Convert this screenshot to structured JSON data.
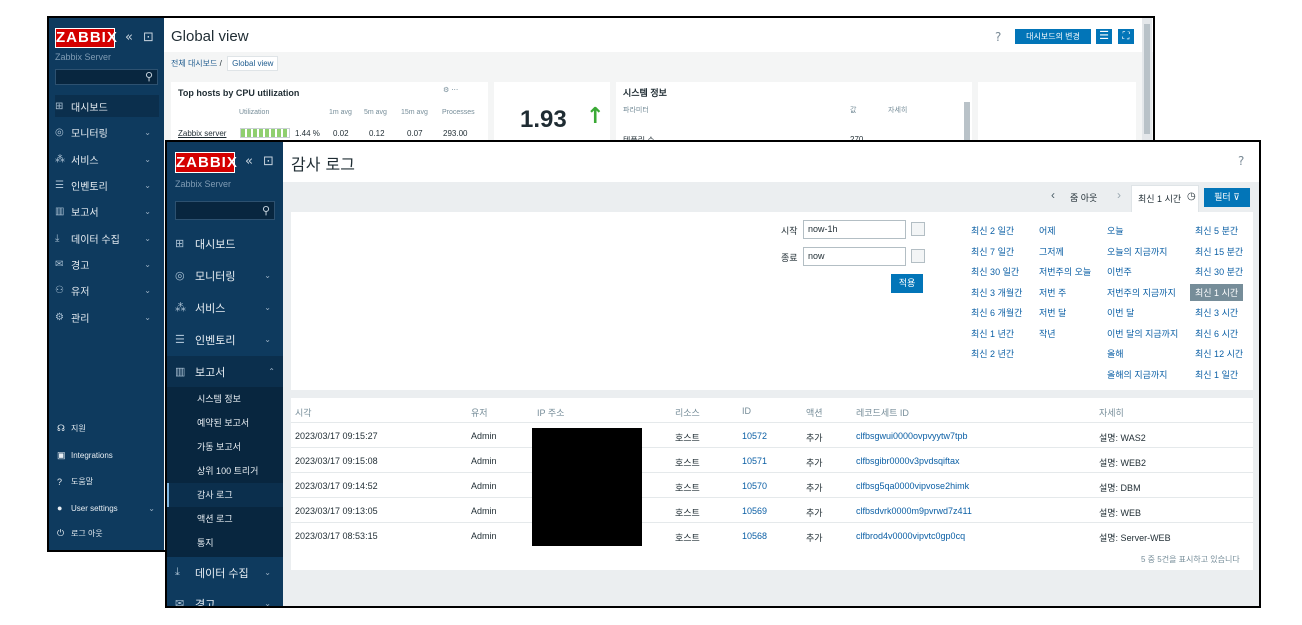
{
  "back": {
    "logo": "ZABBIX",
    "server": "Zabbix Server",
    "nav": [
      "대시보드",
      "모니터링",
      "서비스",
      "인벤토리",
      "보고서",
      "데이터 수집",
      "경고",
      "유저",
      "관리"
    ],
    "bottom": [
      "지원",
      "Integrations",
      "도움말",
      "User settings",
      "로그 아웃"
    ],
    "title": "Global view",
    "help": "?",
    "edit_button": "대시보드의 변경",
    "breadcrumb": [
      "전체 대시보드",
      "/",
      "Global view"
    ],
    "cpu_widget": {
      "title": "Top hosts by CPU utilization",
      "headers": [
        "Utilization",
        "1m avg",
        "5m avg",
        "15m avg",
        "Processes"
      ],
      "row": {
        "host": "Zabbix server",
        "util": "1.44 %",
        "m1": "0.02",
        "m5": "0.12",
        "m15": "0.07",
        "proc": "293.00"
      }
    },
    "gauge": {
      "value": "1.93"
    },
    "sysinfo": {
      "title": "시스템 정보",
      "headers": [
        "파라미터",
        "값",
        "자세히"
      ],
      "row": {
        "param": "템플릿 수",
        "value": "270"
      }
    }
  },
  "front": {
    "logo": "ZABBIX",
    "server": "Zabbix Server",
    "nav": [
      "대시보드",
      "모니터링",
      "서비스",
      "인벤토리",
      "보고서"
    ],
    "submenu": [
      "시스템 정보",
      "예약된 보고서",
      "가동 보고서",
      "상위 100 트리거",
      "감사 로그",
      "액션 로그",
      "통지"
    ],
    "nav_after": [
      "데이터 수집",
      "경고"
    ],
    "title": "감사 로그",
    "help": "?",
    "filter": {
      "zoom_out": "줌 아웃",
      "current": "최신 1 시간",
      "filter_button": "필터",
      "from_label": "시작",
      "from_value": "now-1h",
      "to_label": "종료",
      "to_value": "now",
      "apply": "적용",
      "ranges": [
        [
          "최신 2 일간",
          "최신 7 일간",
          "최신 30 일간",
          "최신 3 개월간",
          "최신 6 개월간",
          "최신 1 년간",
          "최신 2 년간"
        ],
        [
          "어제",
          "그저께",
          "저번주의 오늘",
          "저번 주",
          "저번 달",
          "작년"
        ],
        [
          "오늘",
          "오늘의 지금까지",
          "이번주",
          "저번주의 지금까지",
          "이번 달",
          "이번 달의 지금까지",
          "올해",
          "올해의 지금까지"
        ],
        [
          "최신 5 분간",
          "최신 15 분간",
          "최신 30 분간",
          "최신 1 시간",
          "최신 3 시간",
          "최신 6 시간",
          "최신 12 시간",
          "최신 1 일간"
        ]
      ]
    },
    "table": {
      "headers": [
        "시각",
        "유저",
        "IP 주소",
        "리소스",
        "ID",
        "액션",
        "레코드세트 ID",
        "자세히"
      ],
      "rows": [
        {
          "time": "2023/03/17 09:15:27",
          "user": "Admin",
          "resource": "호스트",
          "id": "10572",
          "action": "추가",
          "recordset": "clfbsgwui0000ovpvyytw7tpb",
          "details": "설명: WAS2"
        },
        {
          "time": "2023/03/17 09:15:08",
          "user": "Admin",
          "resource": "호스트",
          "id": "10571",
          "action": "추가",
          "recordset": "clfbsgibr0000v3pvdsqiftax",
          "details": "설명: WEB2"
        },
        {
          "time": "2023/03/17 09:14:52",
          "user": "Admin",
          "resource": "호스트",
          "id": "10570",
          "action": "추가",
          "recordset": "clfbsg5qa0000vipvose2himk",
          "details": "설명: DBM"
        },
        {
          "time": "2023/03/17 09:13:05",
          "user": "Admin",
          "resource": "호스트",
          "id": "10569",
          "action": "추가",
          "recordset": "clfbsdvrk0000m9pvrwd7z411",
          "details": "설명: WEB"
        },
        {
          "time": "2023/03/17 08:53:15",
          "user": "Admin",
          "resource": "호스트",
          "id": "10568",
          "action": "추가",
          "recordset": "clfbrod4v0000vipvtc0gp0cq",
          "details": "설명: Server-WEB"
        }
      ],
      "footer": "5 중 5건을 표시하고 있습니다"
    }
  }
}
